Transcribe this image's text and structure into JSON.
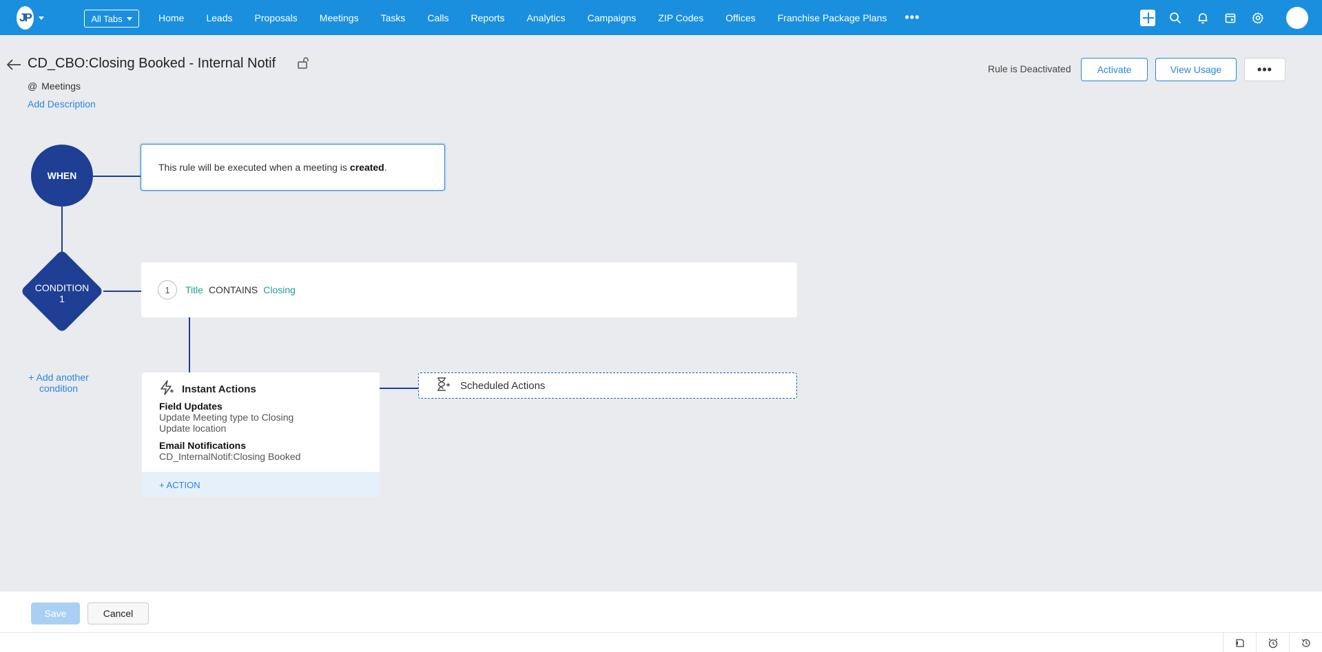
{
  "app": {
    "logo_text": "JP",
    "all_tabs_label": "All Tabs",
    "nav_items": [
      "Home",
      "Leads",
      "Proposals",
      "Meetings",
      "Tasks",
      "Calls",
      "Reports",
      "Analytics",
      "Campaigns",
      "ZIP Codes",
      "Offices",
      "Franchise Package Plans"
    ],
    "nav_more": "•••",
    "icons": [
      "plus-icon",
      "search-icon",
      "bell-icon",
      "calendar-icon",
      "gear-icon",
      "avatar"
    ]
  },
  "header": {
    "title": "CD_CBO:Closing Booked - Internal Notif",
    "module_prefix": "@",
    "module": "Meetings",
    "add_description": "Add Description",
    "rule_status": "Rule is Deactivated",
    "activate_label": "Activate",
    "view_usage_label": "View Usage",
    "more_label": "•••"
  },
  "flow": {
    "when_label": "WHEN",
    "when_text": "This rule will be executed when a meeting is",
    "when_event": "created",
    "when_period": ".",
    "condition_label_line1": "CONDITION",
    "condition_label_line2": "1",
    "condition": {
      "number": "1",
      "field": "Title",
      "operator": "CONTAINS",
      "value": "Closing"
    },
    "add_condition_line1": "+ Add another",
    "add_condition_line2": "condition",
    "instant_actions": {
      "title": "Instant Actions",
      "groups": [
        {
          "title": "Field Updates",
          "items": [
            "Update Meeting type to Closing",
            "Update location"
          ]
        },
        {
          "title": "Email Notifications",
          "items": [
            "CD_InternalNotif:Closing Booked"
          ]
        }
      ],
      "add_action_label": "+ ACTION"
    },
    "scheduled_actions_label": "Scheduled Actions"
  },
  "footer": {
    "save_label": "Save",
    "cancel_label": "Cancel"
  },
  "colors": {
    "topbar": "#1a8fdd",
    "node": "#1e3f94",
    "link": "#2b86d6",
    "condition_field": "#1fa090"
  }
}
